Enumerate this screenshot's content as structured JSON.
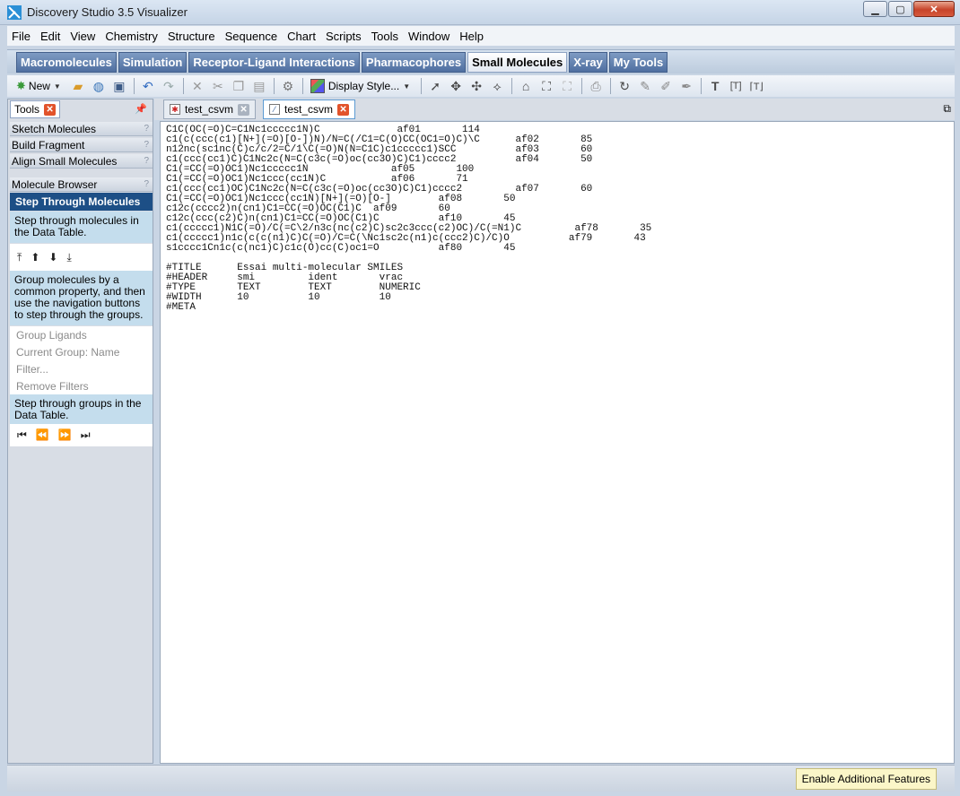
{
  "window": {
    "title": "Discovery Studio 3.5 Visualizer"
  },
  "menu": [
    "File",
    "Edit",
    "View",
    "Chemistry",
    "Structure",
    "Sequence",
    "Chart",
    "Scripts",
    "Tools",
    "Window",
    "Help"
  ],
  "modules": [
    {
      "label": "Macromolecules",
      "active": false
    },
    {
      "label": "Simulation",
      "active": false
    },
    {
      "label": "Receptor-Ligand Interactions",
      "active": false
    },
    {
      "label": "Pharmacophores",
      "active": false
    },
    {
      "label": "Small Molecules",
      "active": true
    },
    {
      "label": "X-ray",
      "active": false
    },
    {
      "label": "My Tools",
      "active": false
    }
  ],
  "toolbar": {
    "new_label": "New",
    "display_style_label": "Display Style..."
  },
  "left_panel": {
    "tab_label": "Tools",
    "sections": [
      "Sketch Molecules",
      "Build Fragment",
      "Align Small Molecules",
      "Molecule Browser"
    ],
    "help_mark": "?",
    "active_tool": "Step Through Molecules",
    "info1": "Step through molecules in the Data Table.",
    "info2": "Group molecules by a common property, and then use the navigation buttons to step through the groups.",
    "group_items": [
      "Group Ligands",
      "Current Group: Name",
      "Filter...",
      "Remove Filters"
    ],
    "info3": "Step through groups in the Data Table."
  },
  "doc_tabs": [
    {
      "label": "test_csvm",
      "active": false
    },
    {
      "label": "test_csvm",
      "active": true
    }
  ],
  "content_lines": [
    "C1C(OC(=O)C=C1Nc1ccccc1N)C             af01       114",
    "c1(c(ccc(c1)[N+](=O)[O-])N)/N=C(/C1=C(O)CC(OC1=O)C)\\C      af02       85",
    "n12nc(sc1nc(C)c/c/2=C/1\\C(=O)N(N=C1C)c1ccccc1)SCC          af03       60",
    "c1(ccc(cc1)C)C1Nc2c(N=C(c3c(=O)oc(cc3O)C)C1)cccc2          af04       50",
    "C1(=CC(=O)OC1)Nc1ccccc1N              af05       100",
    "C1(=CC(=O)OC1)Nc1ccc(cc1N)C           af06       71",
    "c1(ccc(cc1)OC)C1Nc2c(N=C(c3c(=O)oc(cc3O)C)C1)cccc2         af07       60",
    "C1(=CC(=O)OC1)Nc1ccc(cc1N)[N+](=O)[O-]        af08       50",
    "c12c(cccc2)n(cn1)C1=CC(=O)OC(C1)C  af09       60",
    "c12c(ccc(c2)C)n(cn1)C1=CC(=O)OC(C1)C          af10       45",
    "c1(ccccc1)N1C(=O)/C(=C\\2/n3c(nc(c2)C)sc2c3ccc(c2)OC)/C(=N1)C         af78       35",
    "c1(ccccc1)n1c(c(c(n1)C)C(=O)/C=C(\\Nc1sc2c(n1)c(ccc2)C)/C)O          af79       43",
    "s1cccc1Cn1c(c(nc1)C)c1c(O)cc(C)oc1=O          af80       45",
    "",
    "#TITLE      Essai multi-molecular SMILES",
    "#HEADER     smi         ident       vrac",
    "#TYPE       TEXT        TEXT        NUMERIC",
    "#WIDTH      10          10          10",
    "#META"
  ],
  "status": {
    "enable_label": "Enable Additional Features"
  },
  "colors": {
    "accent": "#1d4f86",
    "info_bg": "#c4dded",
    "close_red": "#e2532b"
  }
}
